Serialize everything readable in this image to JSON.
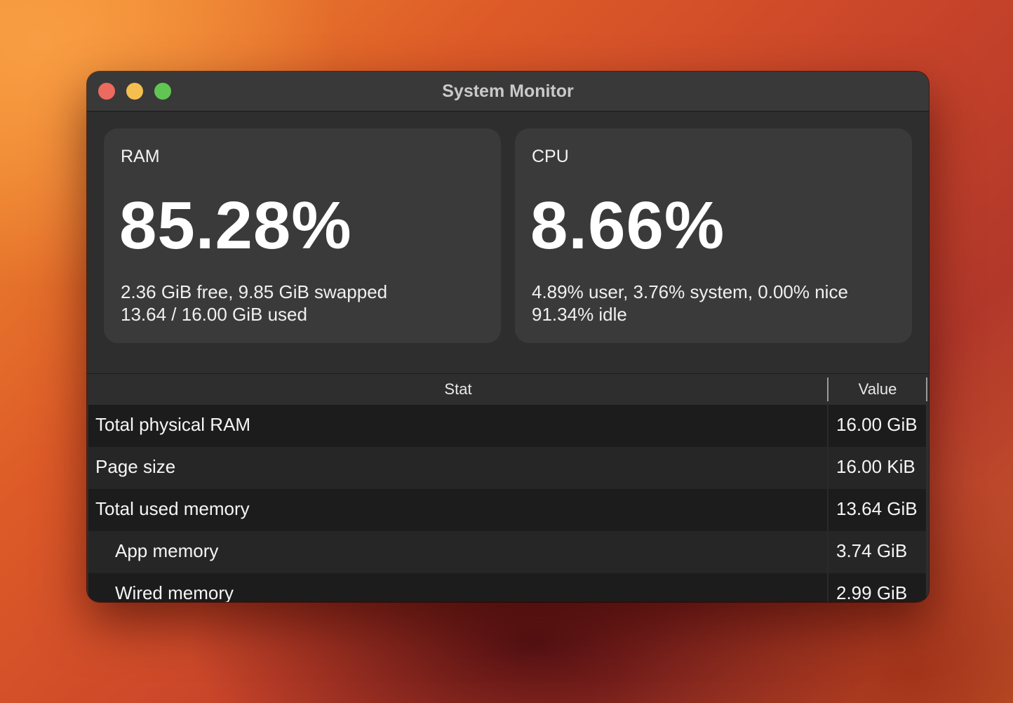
{
  "window": {
    "title": "System Monitor"
  },
  "ram": {
    "label": "RAM",
    "percent": "85.28%",
    "detail_line1": "2.36 GiB free, 9.85 GiB swapped",
    "detail_line2": "13.64 / 16.00 GiB used"
  },
  "cpu": {
    "label": "CPU",
    "percent": "8.66%",
    "detail_line1": "4.89% user, 3.76% system, 0.00% nice",
    "detail_line2": "91.34% idle"
  },
  "table": {
    "headers": {
      "stat": "Stat",
      "value": "Value"
    },
    "rows": [
      {
        "stat": "Total physical RAM",
        "value": "16.00 GiB",
        "indent": false
      },
      {
        "stat": "Page size",
        "value": "16.00 KiB",
        "indent": false
      },
      {
        "stat": "Total used memory",
        "value": "13.64 GiB",
        "indent": false
      },
      {
        "stat": "App memory",
        "value": "3.74 GiB",
        "indent": true
      },
      {
        "stat": "Wired memory",
        "value": "2.99 GiB",
        "indent": true
      }
    ]
  },
  "colors": {
    "close": "#ed6a5e",
    "minimize": "#f5bf4f",
    "zoom": "#61c554",
    "card": "#3a3a3a",
    "row_odd": "#1c1c1c",
    "row_even": "#262626"
  }
}
